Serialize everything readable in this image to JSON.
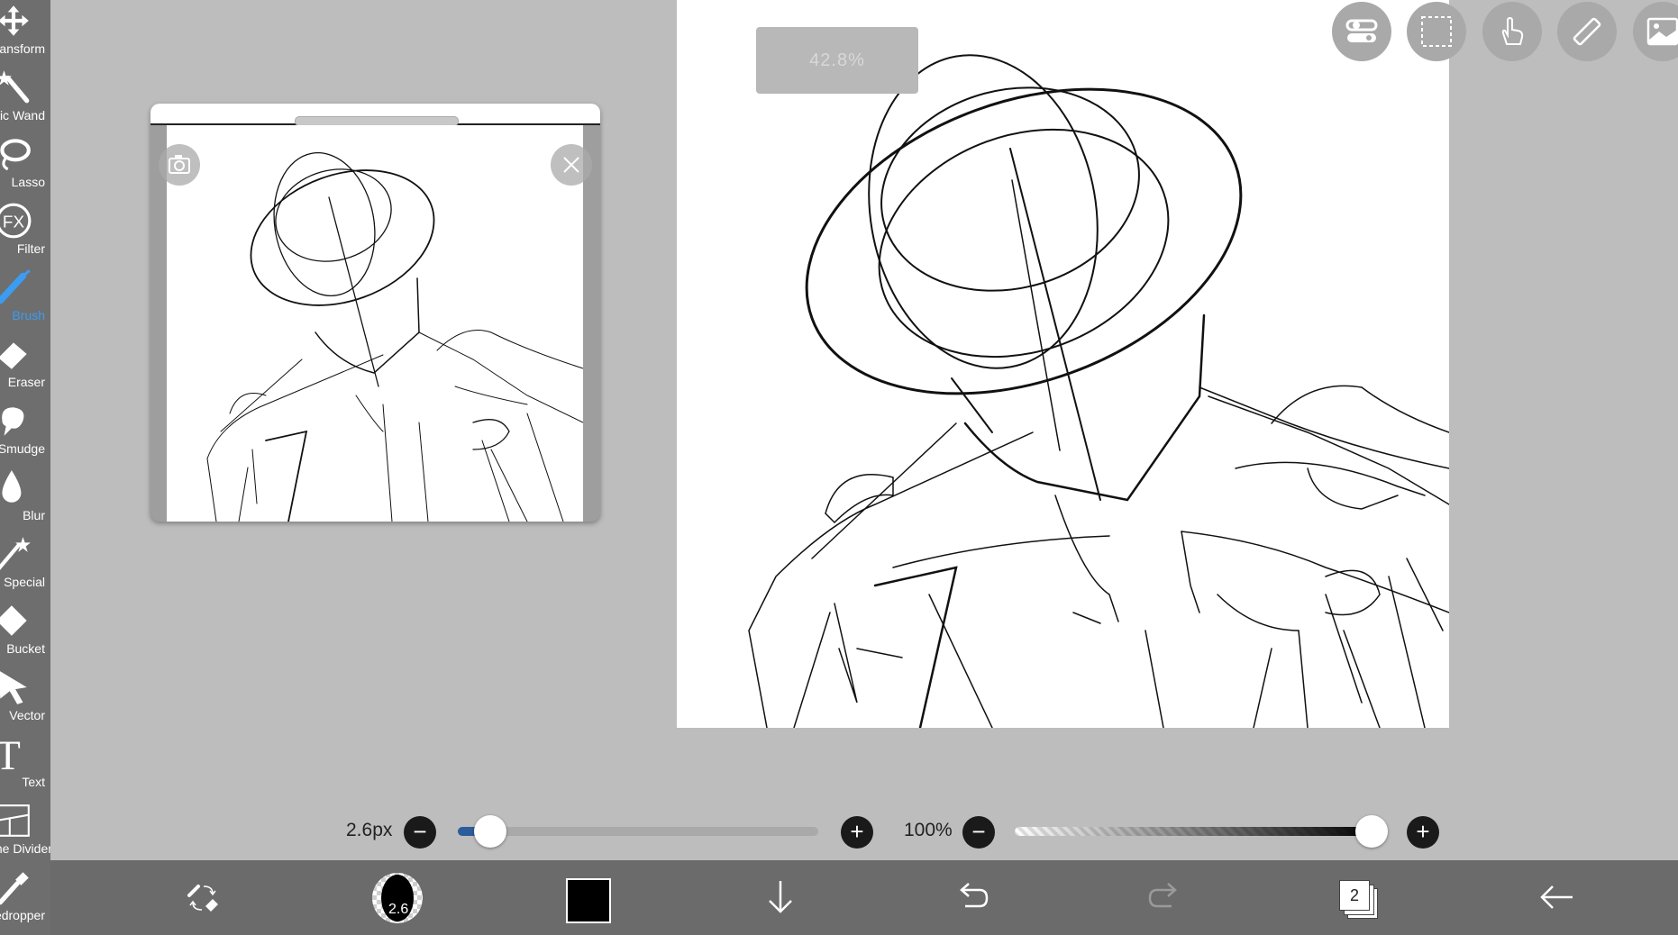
{
  "toolbar": {
    "items": [
      {
        "label": "Transform",
        "icon": "transform-icon"
      },
      {
        "label": "Magic Wand",
        "icon": "magic-wand-icon"
      },
      {
        "label": "Lasso",
        "icon": "lasso-icon"
      },
      {
        "label": "Filter",
        "icon": "fx-icon"
      },
      {
        "label": "Brush",
        "icon": "brush-icon",
        "active": true
      },
      {
        "label": "Eraser",
        "icon": "eraser-icon"
      },
      {
        "label": "Smudge",
        "icon": "smudge-icon"
      },
      {
        "label": "Blur",
        "icon": "blur-icon"
      },
      {
        "label": "Special",
        "icon": "special-icon"
      },
      {
        "label": "Bucket",
        "icon": "bucket-icon"
      },
      {
        "label": "Vector",
        "icon": "vector-icon"
      },
      {
        "label": "Text",
        "icon": "text-icon"
      },
      {
        "label": "Frame Divider",
        "icon": "frame-divider-icon"
      },
      {
        "label": "Eyedropper",
        "icon": "eyedropper-icon"
      }
    ]
  },
  "canvas": {
    "zoom_indicator": "42.8%"
  },
  "top_buttons": [
    "toggle-icon",
    "selection-icon",
    "hand-icon",
    "ruler-icon",
    "image-icon"
  ],
  "brush_size": {
    "label": "2.6px",
    "value_fraction": 0.09
  },
  "opacity": {
    "label": "100%",
    "value_fraction": 1.0
  },
  "bottom_bar": {
    "brush_size_badge": "2.6",
    "layer_count": "2",
    "color": "#000000"
  },
  "colors": {
    "accent": "#3b9cf2",
    "toolbar_bg": "#6e6e6e",
    "workspace_bg": "#bdbdbd",
    "slider_fill": "#2c5c9a"
  }
}
